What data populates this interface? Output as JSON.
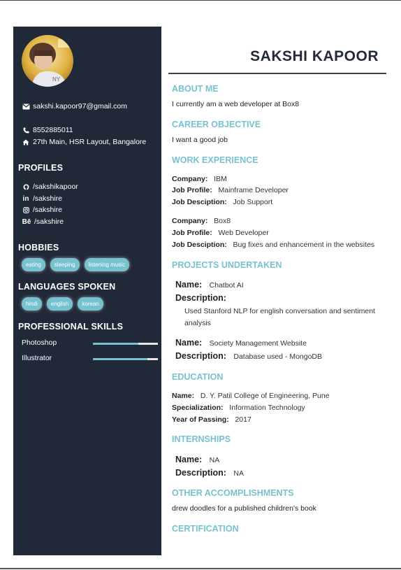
{
  "name": "SAKSHI KAPOOR",
  "contact": {
    "email": "sakshi.kapoor97@gmail.com",
    "phone": "8552885011",
    "address": "27th Main, HSR Layout, Bangalore"
  },
  "profiles": {
    "heading": "PROFILES",
    "github": "/sakshikapoor",
    "linkedin": "/sakshire",
    "instagram": "/sakshire",
    "behance": "/sakshire"
  },
  "hobbies": {
    "heading": "HOBBIES",
    "items": [
      "eating",
      "sleeping",
      "listening music"
    ]
  },
  "languages": {
    "heading": "LANGUAGES SPOKEN",
    "items": [
      "hindi",
      "english",
      "korean"
    ]
  },
  "skills": {
    "heading": "PROFESSIONAL SKILLS",
    "items": [
      {
        "name": "Photoshop",
        "level": 0.7
      },
      {
        "name": "Illustrator",
        "level": 0.84
      }
    ]
  },
  "about": {
    "heading": "ABOUT ME",
    "text": "I currently am a web developer at Box8"
  },
  "objective": {
    "heading": "CAREER OBJECTIVE",
    "text": "I want a good job"
  },
  "work": {
    "heading": "WORK EXPERIENCE",
    "labels": {
      "company": "Company:",
      "profile": "Job Profile:",
      "description": "Job Desciption:"
    },
    "jobs": [
      {
        "company": "IBM",
        "profile": "Mainframe Developer",
        "description": "Job Support"
      },
      {
        "company": "Box8",
        "profile": "Web Developer",
        "description": "Bug fixes and enhancement in the websites"
      }
    ]
  },
  "projects": {
    "heading": "PROJECTS UNDERTAKEN",
    "labels": {
      "name": "Name:",
      "description": "Description:"
    },
    "items": [
      {
        "name": "Chatbot AI",
        "description": "Used Stanford NLP for english conversation and sentiment analysis"
      },
      {
        "name": "Society Management Website",
        "description": "Database used - MongoDB"
      }
    ]
  },
  "education": {
    "heading": "EDUCATION",
    "labels": {
      "name": "Name:",
      "specialization": "Specialization:",
      "year": "Year of Passing:"
    },
    "name": "D. Y. Patil College of Engineering, Pune",
    "specialization": "Information Technology",
    "year": "2017"
  },
  "internships": {
    "heading": "INTERNSHIPS",
    "labels": {
      "name": "Name:",
      "description": "Description:"
    },
    "name": "NA",
    "description": "NA"
  },
  "accomplishments": {
    "heading": "OTHER ACCOMPLISHMENTS",
    "text": "drew doodles for a published children's book"
  },
  "certification": {
    "heading": "CERTIFICATION"
  },
  "colors": {
    "sidebar": "#212939",
    "accent": "#77c2cf",
    "heading_dark": "#222b37"
  },
  "icons": [
    "envelope-icon",
    "phone-icon",
    "home-icon",
    "github-icon",
    "linkedin-icon",
    "instagram-icon",
    "behance-icon"
  ]
}
